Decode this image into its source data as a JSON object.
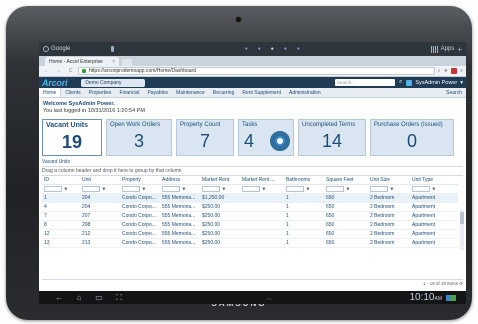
{
  "device": {
    "brand": "SAMSUNG"
  },
  "android": {
    "search_label": "Google",
    "apps_label": "Apps"
  },
  "browser": {
    "tab_title": "Home - Accel Enterprise",
    "url": "https://arcoriprodemoapp.com/Home/Dashboard"
  },
  "app": {
    "logo": "Arcori",
    "company": "Demo Company",
    "search_placeholder": "Search...",
    "user": "SysAdmin Power"
  },
  "menu": {
    "items": [
      "Home",
      "Clients",
      "Properties",
      "Financial",
      "Payables",
      "Maintenance",
      "Recurring",
      "Rent Supplement",
      "Administration"
    ],
    "right": "Search"
  },
  "welcome": {
    "title": "Welcome SysAdmin Power.",
    "last_login": "You last logged in 10/31/2016 1:20:54 PM"
  },
  "tiles": [
    {
      "label": "Vacant Units",
      "value": "19"
    },
    {
      "label": "Open Work Orders",
      "value": "3"
    },
    {
      "label": "Property Count",
      "value": "7"
    },
    {
      "label": "Tasks",
      "value": "4"
    },
    {
      "label": "Uncompleted Terms",
      "value": "14"
    },
    {
      "label": "Purchase Orders (Issued)",
      "value": "0"
    }
  ],
  "grid": {
    "title": "Vacant Units",
    "group_hint": "Drag a column header and drop it here to group by that column",
    "columns": [
      "ID",
      "Unit",
      "Property",
      "Address",
      "Market Rent",
      "Market Rent ...",
      "Bathrooms",
      "Square Feet",
      "Unit Size",
      "Unit Type"
    ],
    "rows": [
      [
        "1",
        "204",
        "Condo Corpo...",
        "555 Memoria...",
        "$1,250.00",
        "",
        "1",
        "650",
        "2 Bedroom",
        "Apartment"
      ],
      [
        "4",
        "204",
        "Condo Corpo...",
        "555 Memoria...",
        "$250.00",
        "",
        "1",
        "650",
        "2 Bedroom",
        "Apartment"
      ],
      [
        "7",
        "207",
        "Condo Corpo...",
        "555 Memoria...",
        "$250.00",
        "",
        "1",
        "650",
        "2 Bedroom",
        "Apartment"
      ],
      [
        "8",
        "208",
        "Condo Corpo...",
        "555 Memoria...",
        "$250.00",
        "",
        "1",
        "650",
        "2 Bedroom",
        "Apartment"
      ],
      [
        "12",
        "212",
        "Condo Corpo...",
        "555 Memoria...",
        "$250.00",
        "",
        "1",
        "650",
        "2 Bedroom",
        "Apartment"
      ],
      [
        "13",
        "213",
        "Condo Corpo...",
        "555 Memoria...",
        "$250.00",
        "",
        "1",
        "650",
        "2 Bedroom",
        "Apartment"
      ]
    ],
    "pager": "1 - 19 of 19 items"
  },
  "navbar": {
    "time": "10:10",
    "ampm": "AM"
  }
}
